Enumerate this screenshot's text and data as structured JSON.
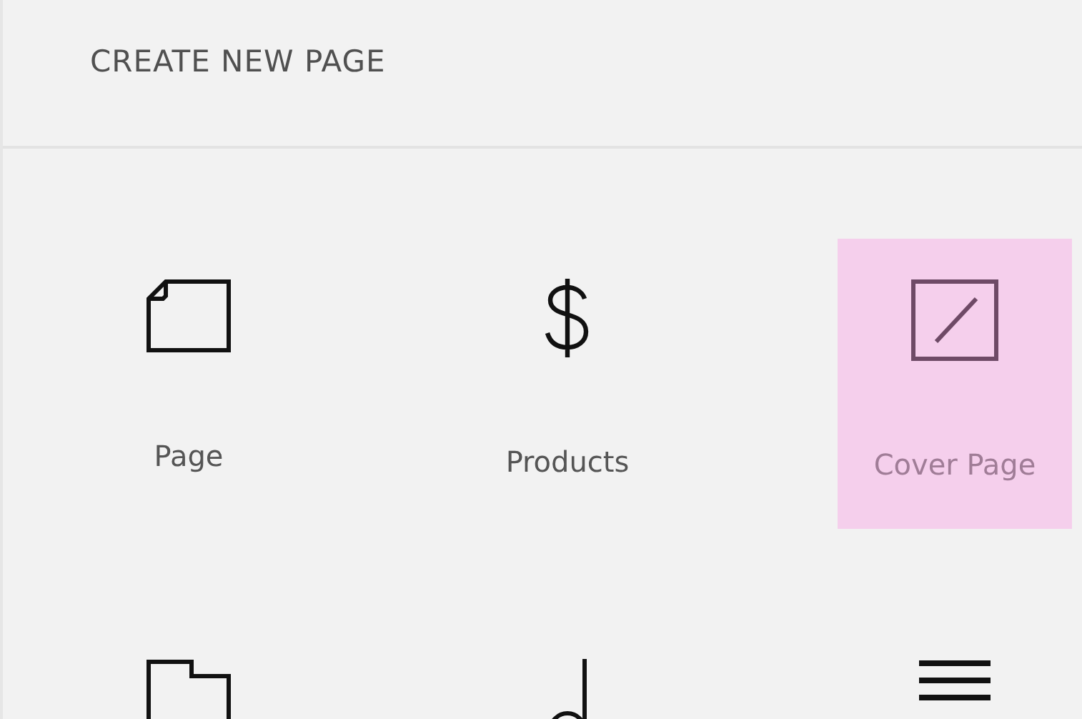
{
  "header": {
    "title": "CREATE NEW PAGE"
  },
  "page_types": [
    {
      "kind": "page",
      "label": "Page",
      "selected": false
    },
    {
      "kind": "products",
      "label": "Products",
      "selected": false
    },
    {
      "kind": "cover",
      "label": "Cover Page",
      "selected": true
    },
    {
      "kind": "folder",
      "selected": false
    },
    {
      "kind": "audio",
      "selected": false
    },
    {
      "kind": "index",
      "selected": false
    }
  ]
}
